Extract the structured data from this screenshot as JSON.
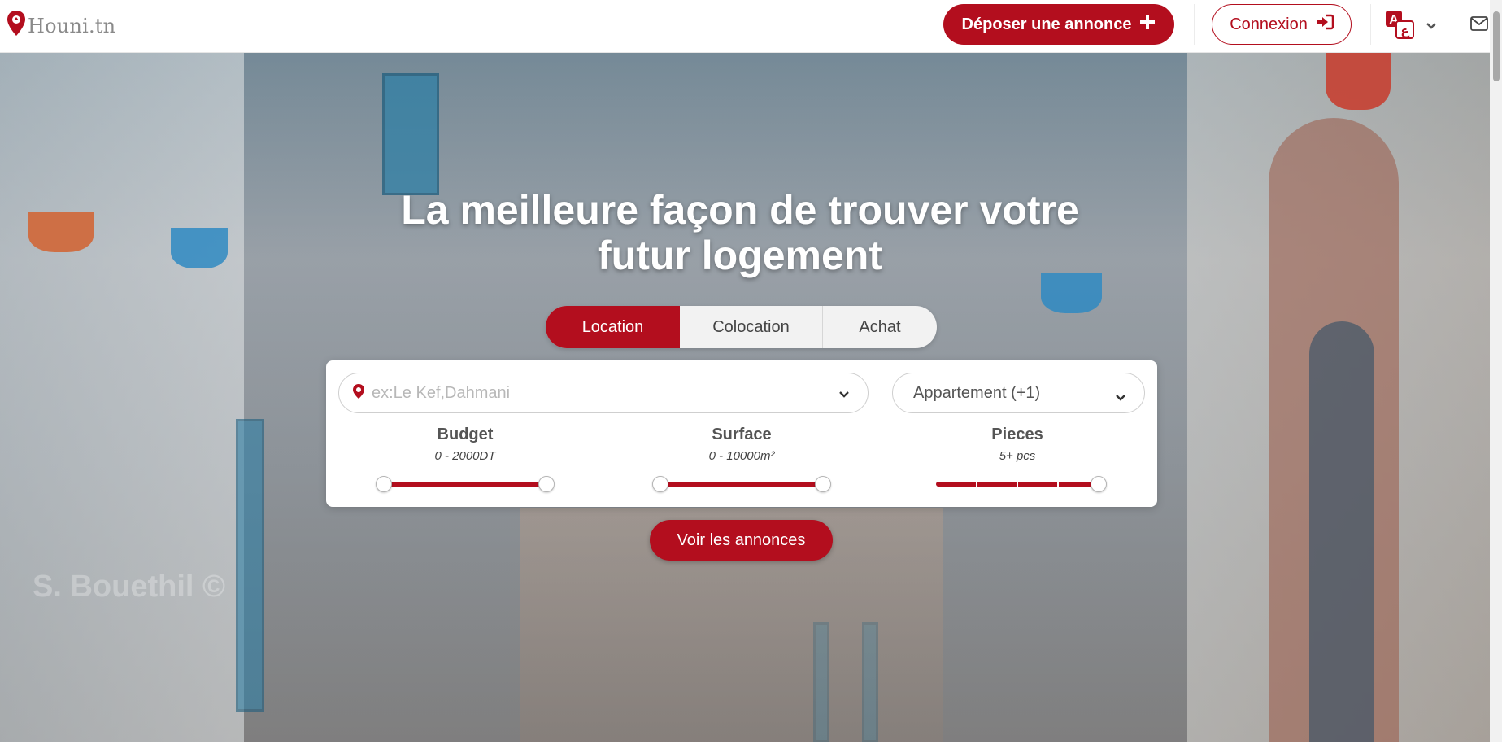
{
  "header": {
    "logo_text": "Houni.tn",
    "post_button_label": "Déposer une annonce",
    "login_button_label": "Connexion",
    "language_icon": "translate-icon",
    "mail_icon": "mail-icon"
  },
  "hero": {
    "headline_line1": "La meilleure façon de trouver votre",
    "headline_line2": "futur logement",
    "watermark": "S. Bouethil ©"
  },
  "tabs": [
    {
      "label": "Location",
      "active": true
    },
    {
      "label": "Colocation",
      "active": false
    },
    {
      "label": "Achat",
      "active": false
    }
  ],
  "search": {
    "location_placeholder": "ex:Le Kef,Dahmani",
    "property_type_value": "Appartement (+1)",
    "filters": [
      {
        "title": "Budget",
        "range": "0 - 2000DT",
        "min_fraction": 0,
        "max_fraction": 1
      },
      {
        "title": "Surface",
        "range": "0 - 10000m²",
        "min_fraction": 0,
        "max_fraction": 1
      },
      {
        "title": "Pieces",
        "range": "5+ pcs",
        "value_fraction": 1
      }
    ],
    "submit_label": "Voir les annonces"
  },
  "colors": {
    "brand_red": "#b30e1e",
    "logo_gray": "#8a8a8a"
  }
}
